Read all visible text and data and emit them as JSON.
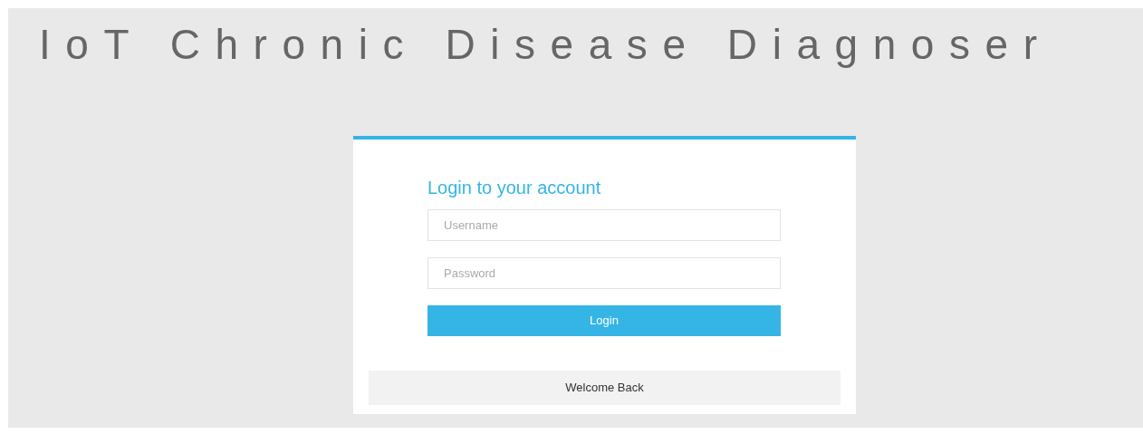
{
  "title": "IoT Chronic Disease Diagnoser",
  "login_card": {
    "heading": "Login to your account",
    "fields": [
      {
        "placeholder": "Username"
      },
      {
        "placeholder": "Password"
      }
    ],
    "button": "Login",
    "footer": "Welcome Back"
  }
}
